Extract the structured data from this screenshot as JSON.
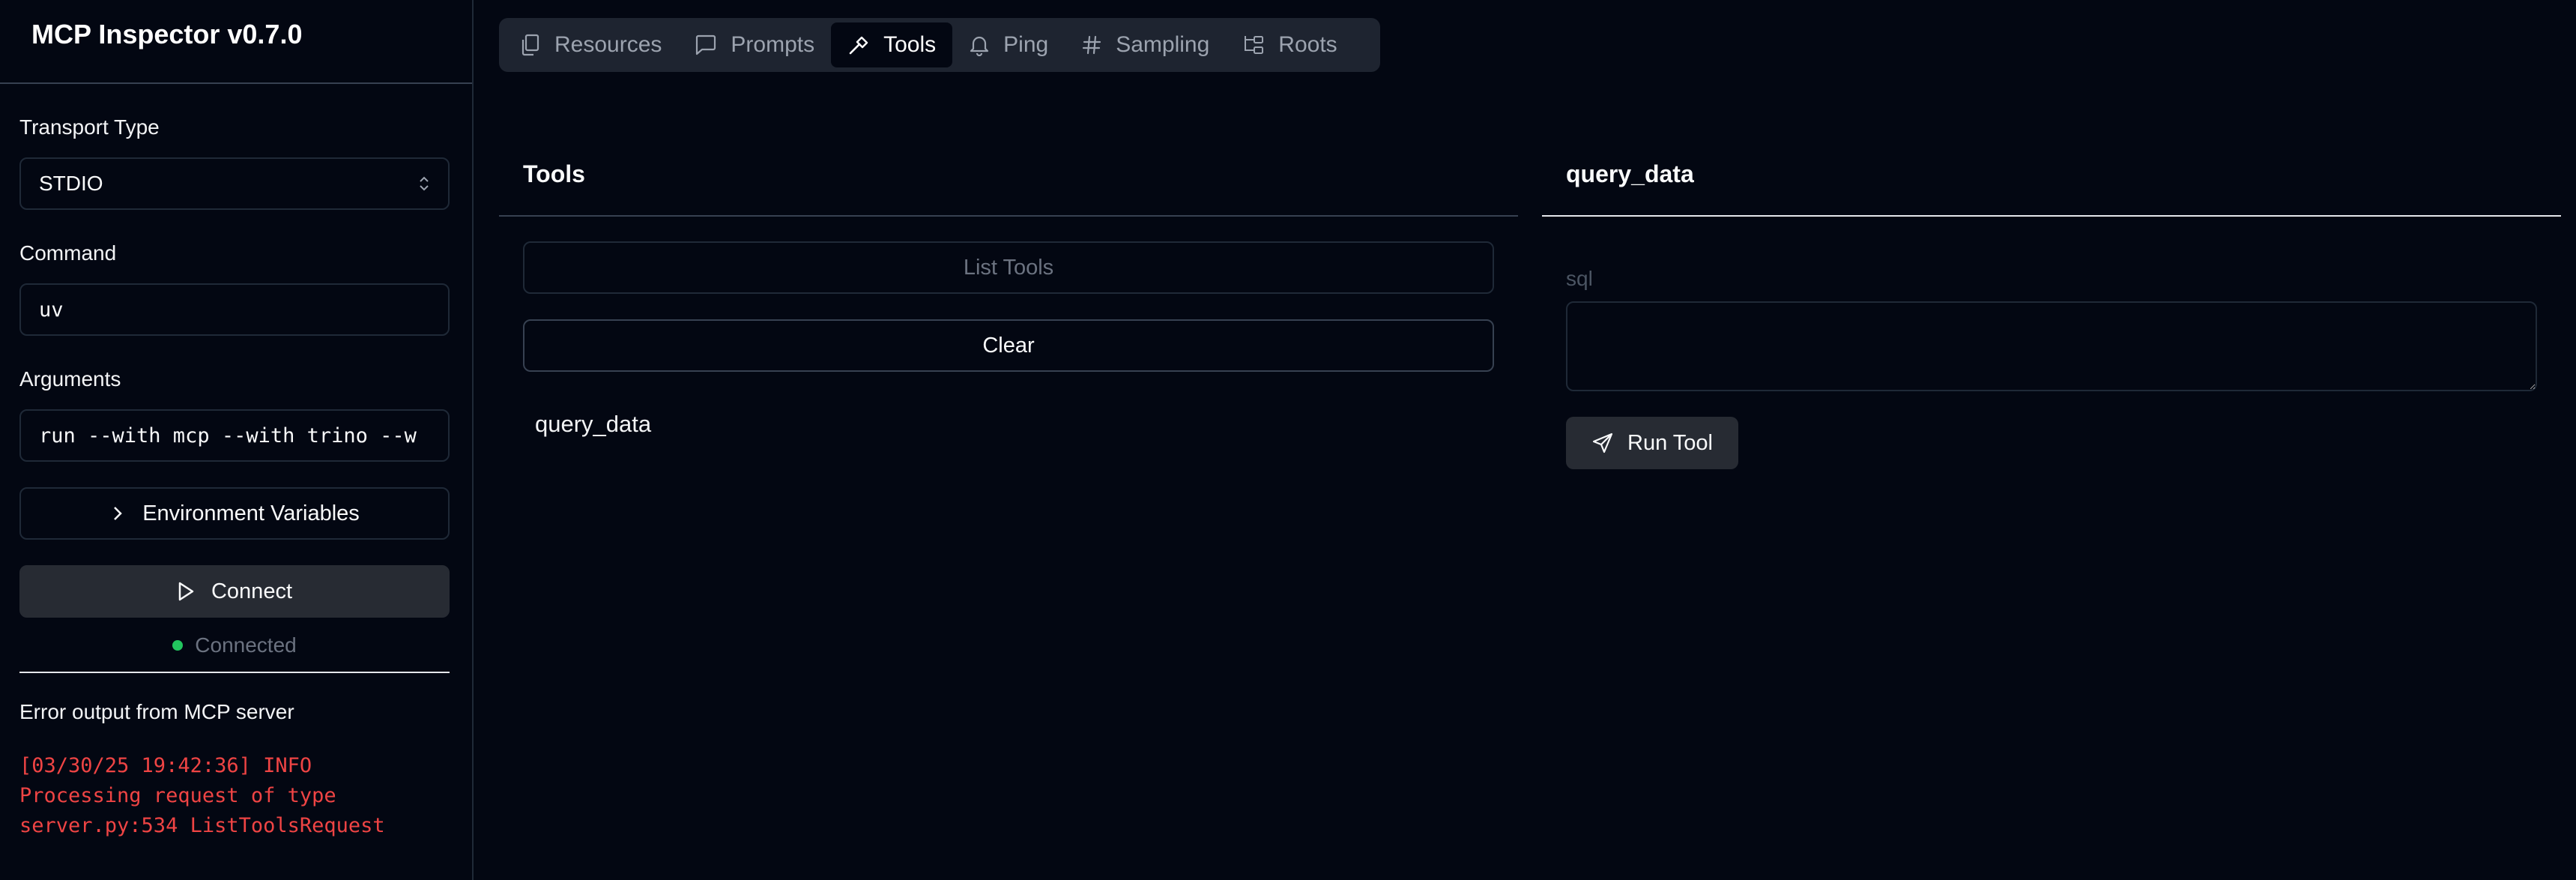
{
  "app": {
    "title": "MCP Inspector v0.7.0"
  },
  "sidebar": {
    "transport_label": "Transport Type",
    "transport_value": "STDIO",
    "command_label": "Command",
    "command_value": "uv",
    "arguments_label": "Arguments",
    "arguments_value": "run --with mcp --with trino --w",
    "env_button": "Environment Variables",
    "connect_button": "Connect",
    "status": "Connected",
    "error_title": "Error output from MCP server",
    "error_lines": [
      "[03/30/25 19:42:36] INFO",
      "Processing request of type",
      "server.py:534 ListToolsRequest"
    ]
  },
  "tabs": [
    {
      "label": "Resources",
      "icon": "files-icon"
    },
    {
      "label": "Prompts",
      "icon": "message-square-icon"
    },
    {
      "label": "Tools",
      "icon": "hammer-icon",
      "active": true
    },
    {
      "label": "Ping",
      "icon": "bell-icon"
    },
    {
      "label": "Sampling",
      "icon": "hash-icon"
    },
    {
      "label": "Roots",
      "icon": "folder-tree-icon"
    }
  ],
  "tools_panel": {
    "title": "Tools",
    "list_button": "List Tools",
    "clear_button": "Clear",
    "items": [
      "query_data"
    ]
  },
  "detail_panel": {
    "title": "query_data",
    "param_label": "sql",
    "param_value": "",
    "run_button": "Run Tool"
  },
  "colors": {
    "background": "#030712",
    "accent_status": "#22c55e",
    "error_text": "#ef4444",
    "button_fill": "#272b33"
  }
}
